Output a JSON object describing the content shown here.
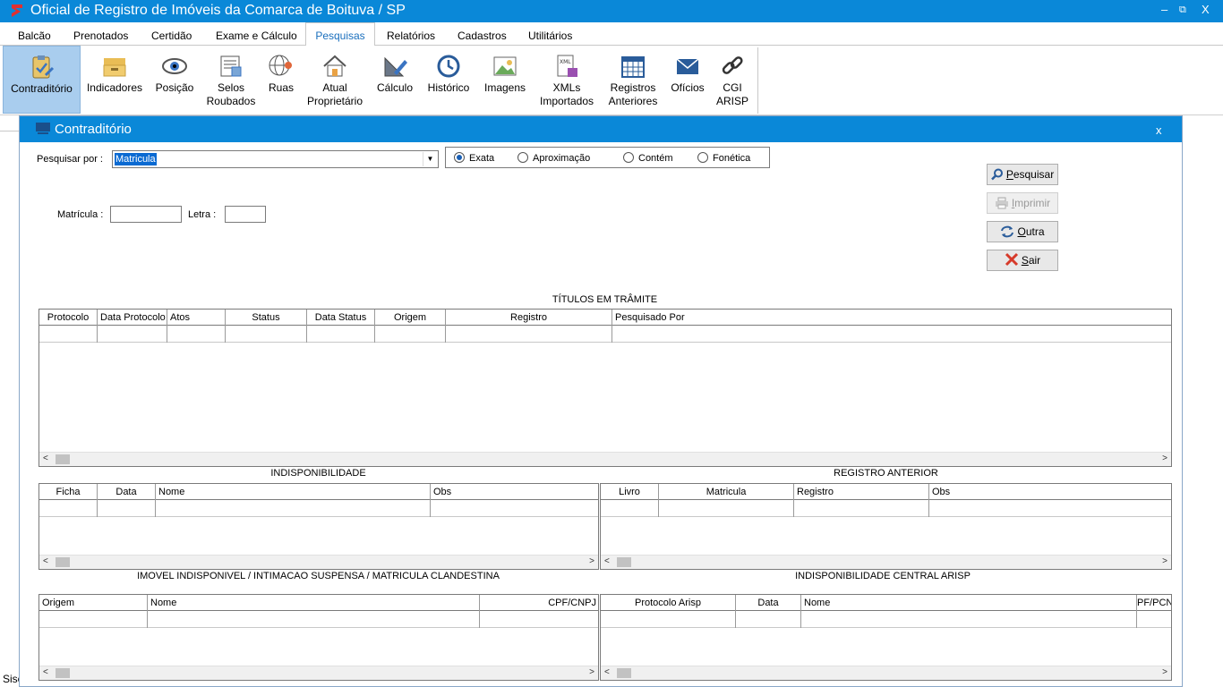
{
  "window": {
    "title": "Oficial de Registro de Imóveis da Comarca de Boituva / SP",
    "minimize": "–",
    "restore": "⧉",
    "close": "X"
  },
  "menu": [
    "Balcão",
    "Prenotados",
    "Certidão",
    "Exame e Cálculo",
    "Pesquisas",
    "Relatórios",
    "Cadastros",
    "Utilitários"
  ],
  "ribbon": [
    {
      "line1": "Contraditório",
      "line2": "",
      "icon": "clipboard-check-icon"
    },
    {
      "line1": "Indicadores",
      "line2": "",
      "icon": "folders-icon"
    },
    {
      "line1": "Posição",
      "line2": "",
      "icon": "eye-icon"
    },
    {
      "line1": "Selos",
      "line2": "Roubados",
      "icon": "document-stamp-icon"
    },
    {
      "line1": "Ruas",
      "line2": "",
      "icon": "globe-pin-icon"
    },
    {
      "line1": "Atual",
      "line2": "Proprietário",
      "icon": "house-icon"
    },
    {
      "line1": "Cálculo",
      "line2": "",
      "icon": "ruler-pencil-icon"
    },
    {
      "line1": "Histórico",
      "line2": "",
      "icon": "history-clock-icon"
    },
    {
      "line1": "Imagens",
      "line2": "",
      "icon": "image-icon"
    },
    {
      "line1": "XMLs",
      "line2": "Importados",
      "icon": "xml-file-icon"
    },
    {
      "line1": "Registros",
      "line2": "Anteriores",
      "icon": "calendar-grid-icon"
    },
    {
      "line1": "Ofícios",
      "line2": "",
      "icon": "envelope-icon"
    },
    {
      "line1": "CGI",
      "line2": "ARISP",
      "icon": "link-chain-icon"
    }
  ],
  "status_left": "Sisc",
  "dialog": {
    "title": "Contraditório",
    "close": "x",
    "search_by_label": "Pesquisar por :",
    "search_by_value": "Matricula",
    "match_options": [
      {
        "label": "Exata",
        "selected": true
      },
      {
        "label": "Aproximação",
        "selected": false
      },
      {
        "label": "Contém",
        "selected": false
      },
      {
        "label": "Fonética",
        "selected": false
      }
    ],
    "matricula_label": "Matrícula :",
    "letra_label": "Letra :",
    "buttons": {
      "pesquisar": {
        "underlined": "P",
        "rest": "esquisar"
      },
      "imprimir": {
        "underlined": "I",
        "rest": "mprimir"
      },
      "outra": {
        "underlined": "O",
        "rest": "utra"
      },
      "sair": {
        "underlined": "S",
        "rest": "air"
      }
    },
    "titulos": {
      "title": "TÍTULOS EM TRÂMITE",
      "columns": [
        "Protocolo",
        "Data Protocolo",
        "Atos",
        "Status",
        "Data Status",
        "Origem",
        "Registro",
        "Pesquisado Por"
      ]
    },
    "indisponibilidade": {
      "title": "INDISPONIBILIDADE",
      "columns": [
        "Ficha",
        "Data",
        "Nome",
        "Obs"
      ]
    },
    "registro_anterior": {
      "title": "REGISTRO ANTERIOR",
      "columns": [
        "Livro",
        "Matricula",
        "Registro",
        "Obs"
      ]
    },
    "imovel": {
      "title": "IMOVEL INDISPONIVEL / INTIMACAO SUSPENSA / MATRICULA CLANDESTINA",
      "columns": [
        "Origem",
        "Nome",
        "CPF/CNPJ"
      ]
    },
    "central_arisp": {
      "title": "INDISPONIBILIDADE CENTRAL ARISP",
      "columns": [
        "Protocolo Arisp",
        "Data",
        "Nome",
        "PF/PCN"
      ]
    }
  },
  "colors": {
    "accent": "#0a88d8",
    "selected_ribbon": "#a9cdee",
    "active_tab_text": "#1a6fbd"
  }
}
